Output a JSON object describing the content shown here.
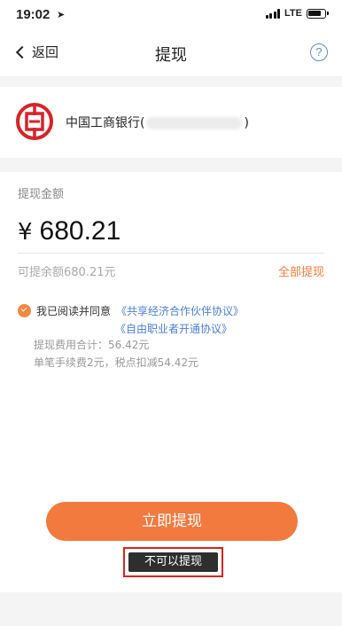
{
  "status_bar": {
    "time": "19:02",
    "network": "LTE"
  },
  "nav": {
    "back_label": "返回",
    "title": "提现",
    "help_symbol": "?"
  },
  "bank": {
    "name_prefix": "中国工商银行(",
    "name_suffix": ")",
    "brand_color": "#d7232a"
  },
  "withdraw": {
    "amount_label": "提现金额",
    "currency_symbol": "¥",
    "amount": "680.21",
    "available_text": "可提余额680.21元",
    "withdraw_all_label": "全部提现"
  },
  "agreement": {
    "prefix": "我已阅读并同意",
    "link1": "《共享经济合作伙伴协议》",
    "link2": "《自由职业者开通协议》",
    "fee_total": "提现费用合计：56.42元",
    "fee_detail": "单笔手续费2元，税点扣减54.42元"
  },
  "actions": {
    "submit_label": "立即提现",
    "toast_text": "不可以提现"
  },
  "colors": {
    "accent": "#f27a3e",
    "link": "#4a7fd8",
    "alert_outline": "#e02020"
  }
}
